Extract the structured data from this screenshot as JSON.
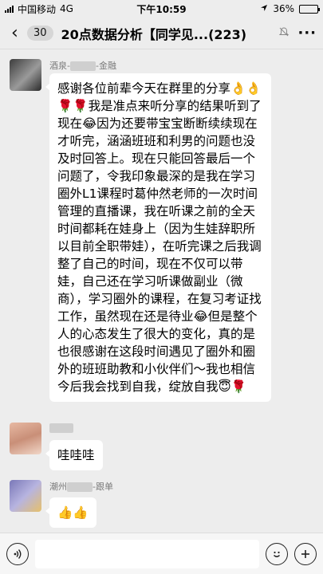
{
  "status": {
    "carrier": "中国移动",
    "network": "4G",
    "time": "下午10:59",
    "battery_text": "36%",
    "battery_level": 0.36
  },
  "nav": {
    "title": "20点数据分析【同学见...",
    "member_count": "(223)",
    "unread_badge": "30"
  },
  "messages": [
    {
      "sender_prefix": "酒泉-",
      "sender_suffix": "-金融",
      "text": "感谢各位前辈今天在群里的分享👌👌🌹🌹我是准点来听分享的结果听到了现在😂因为还要带宝宝断断续续现在才听完，涵涵班班和利男的问题也没及时回答上。现在只能回答最后一个问题了，令我印象最深的是我在学习圈外L1课程时葛仲然老师的一次时间管理的直播课，我在听课之前的全天时间都耗在娃身上（因为生娃辞职所以目前全职带娃），在听完课之后我调整了自己的时间，现在不仅可以带娃，自己还在学习听课做副业（微商），学习圈外的课程，在复习考证找工作，虽然现在还是待业😂但是整个人的心态发生了很大的变化，真的是也很感谢在这段时间遇见了圈外和圈外的班班助教和小伙伴们～我也相信今后我会找到自我，绽放自我😇🌹"
    },
    {
      "sender_prefix": "",
      "sender_suffix": "",
      "text": "哇哇哇"
    },
    {
      "sender_prefix": "潮州",
      "sender_suffix": "-跟单",
      "text": "👍👍"
    }
  ]
}
